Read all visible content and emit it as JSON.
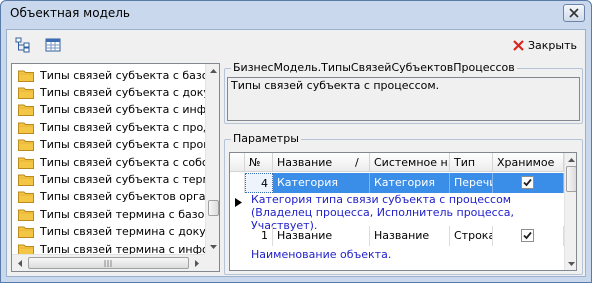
{
  "window": {
    "title": "Объектная модель"
  },
  "toolbar": {
    "close_label": "Закрыть"
  },
  "tree": {
    "items": [
      "Типы связей субъекта с базовы",
      "Типы связей субъекта с докуме",
      "Типы связей субъекта с информ",
      "Типы связей субъекта с продук",
      "Типы связей субъекта с процесс",
      "Типы связей субъекта с собств",
      "Типы связей субъекта с термин",
      "Типы связей субъектов организ",
      "Типы связей термина с базовым",
      "Типы связей термина с докумен",
      "Типы связей термина с информ"
    ]
  },
  "entity": {
    "name": "БизнесМодель.ТипыСвязейСубъектовПроцессов",
    "description": "Типы связей субъекта с процессом."
  },
  "params": {
    "title": "Параметры",
    "columns": [
      "№",
      "Название",
      "Системное н...",
      "Тип",
      "Хранимое"
    ],
    "sort_indicator": "/",
    "rows": [
      {
        "num": "4",
        "name": "Категория",
        "system_name": "Категория",
        "type": "Перечис...",
        "stored": true,
        "note": "Категория типа связи субъекта с процессом (Владелец процесса, Исполнитель процесса, Участвует)."
      },
      {
        "num": "1",
        "name": "Название",
        "system_name": "Название",
        "type": "Строка",
        "stored": true,
        "note": "Наименование объекта."
      }
    ]
  },
  "colors": {
    "selection": "#3a8ee8",
    "note_text": "#1e1ec8",
    "title_bar": "#c9d8ec",
    "close_red": "#d8261f"
  },
  "icons": [
    "hierarchy-icon",
    "table-icon",
    "close-x-icon",
    "folder-icon",
    "row-pointer-icon"
  ]
}
